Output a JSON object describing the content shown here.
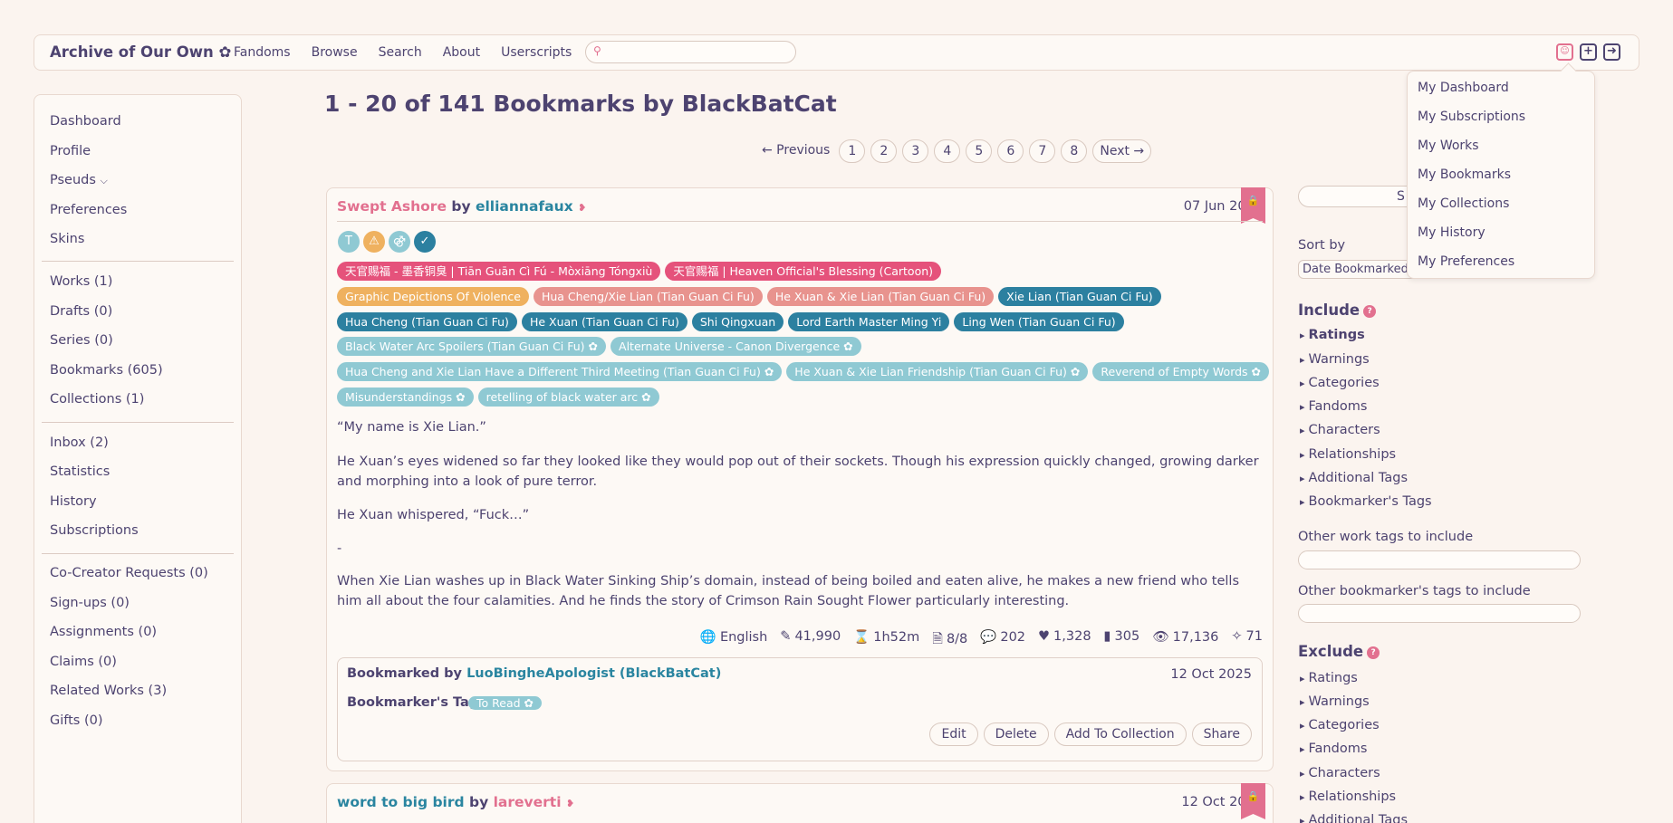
{
  "header": {
    "brand": "Archive of Our Own ✿",
    "nav": [
      "Fandoms",
      "Browse",
      "Search",
      "About",
      "Userscripts"
    ],
    "icons": [
      "user-icon",
      "new-work-icon",
      "logout-icon"
    ]
  },
  "sidebar": {
    "items": [
      "Dashboard",
      "Profile",
      "Pseuds",
      "Preferences",
      "Skins",
      "Works (1)",
      "Drafts (0)",
      "Series (0)",
      "Bookmarks (605)",
      "Collections (1)",
      "Inbox (2)",
      "Statistics",
      "History",
      "Subscriptions",
      "Co-Creator Requests (0)",
      "Sign-ups (0)",
      "Assignments (0)",
      "Claims (0)",
      "Related Works (3)",
      "Gifts (0)"
    ]
  },
  "main": {
    "heading": "1 - 20 of 141 Bookmarks by BlackBatCat",
    "pagination": [
      "← Previous",
      "1",
      "2",
      "3",
      "4",
      "5",
      "6",
      "7",
      "8",
      "Next →"
    ],
    "bookmarks": [
      {
        "title": "Swept Ashore",
        "by": " by ",
        "author": "elliannafaux",
        "date": "07 Jun 2025",
        "fandom_tags": [
          "天官赐福 - 墨香铜臭 | Tiān Guān Cì Fú - Mòxiāng Tóngxiù",
          "天官赐福 | Heaven Official's Blessing (Cartoon)"
        ],
        "warning_tags": [
          "Graphic Depictions Of Violence"
        ],
        "relationship_tags": [
          "Hua Cheng/Xie Lian (Tian Guan Ci Fu)",
          "He Xuan & Xie Lian (Tian Guan Ci Fu)"
        ],
        "character_tags": [
          "Xie Lian (Tian Guan Ci Fu)",
          "Hua Cheng (Tian Guan Ci Fu)",
          "He Xuan (Tian Guan Ci Fu)",
          "Shi Qingxuan",
          "Lord Earth Master Ming Yi",
          "Ling Wen (Tian Guan Ci Fu)"
        ],
        "freeform_tags": [
          "Black Water Arc Spoilers (Tian Guan Ci Fu) ✿",
          "Alternate Universe - Canon Divergence ✿",
          "Hua Cheng and Xie Lian Have a Different Third Meeting (Tian Guan Ci Fu) ✿",
          "He Xuan & Xie Lian Friendship (Tian Guan Ci Fu) ✿",
          "Reverend of Empty Words ✿",
          "Misunderstandings ✿",
          "retelling of black water arc ✿"
        ],
        "summary": [
          "“My name is Xie Lian.”",
          "He Xuan’s eyes widened so far they looked like they would pop out of their sockets. Though his expression quickly changed, growing darker and morphing into a look of pure terror.",
          "He Xuan whispered, “Fuck…”",
          "-",
          "When Xie Lian washes up in Black Water Sinking Ship’s domain, instead of being boiled and eaten alive, he makes a new friend who tells him all about the four calamities. And he finds the story of Crimson Rain Sought Flower particularly interesting."
        ],
        "stats": {
          "language": "English",
          "words": "41,990",
          "time": "1h52m",
          "chapters": "8/8",
          "comments": "202",
          "kudos": "1,328",
          "bookmarks": "305",
          "hits": "17,136",
          "extra": "71"
        },
        "bookmarker_label": "Bookmarked by ",
        "bookmarker": "LuoBingheApologist (BlackBatCat)",
        "bookmark_date": "12 Oct 2025",
        "bookmarker_tags_label": "Bookmarker's Tags:",
        "bookmarker_tags": [
          "To Read ✿"
        ],
        "actions": [
          "Edit",
          "Delete",
          "Add To Collection",
          "Share"
        ]
      },
      {
        "title": "word to big bird",
        "by": " by ",
        "author": "lareverti",
        "date": "12 Oct 2025"
      }
    ]
  },
  "filters": {
    "sort_by_label": "Sort by",
    "sort_value": "Date Bookmarked",
    "include_label": "Include",
    "include_items": [
      "Ratings",
      "Warnings",
      "Categories",
      "Fandoms",
      "Characters",
      "Relationships",
      "Additional Tags",
      "Bookmarker's Tags"
    ],
    "other_work_tags_label": "Other work tags to include",
    "other_bm_tags_label": "Other bookmarker's tags to include",
    "exclude_label": "Exclude",
    "exclude_items": [
      "Ratings",
      "Warnings",
      "Categories",
      "Fandoms",
      "Characters",
      "Relationships",
      "Additional Tags"
    ],
    "sort_button_partial": "S"
  },
  "user_menu": [
    "My Dashboard",
    "My Subscriptions",
    "My Works",
    "My Bookmarks",
    "My Collections",
    "My History",
    "My Preferences"
  ],
  "colors": {
    "accent_pink": "#e2708f",
    "link_teal": "#2a85a0",
    "text": "#4d4370",
    "background": "#fbf4ef"
  }
}
